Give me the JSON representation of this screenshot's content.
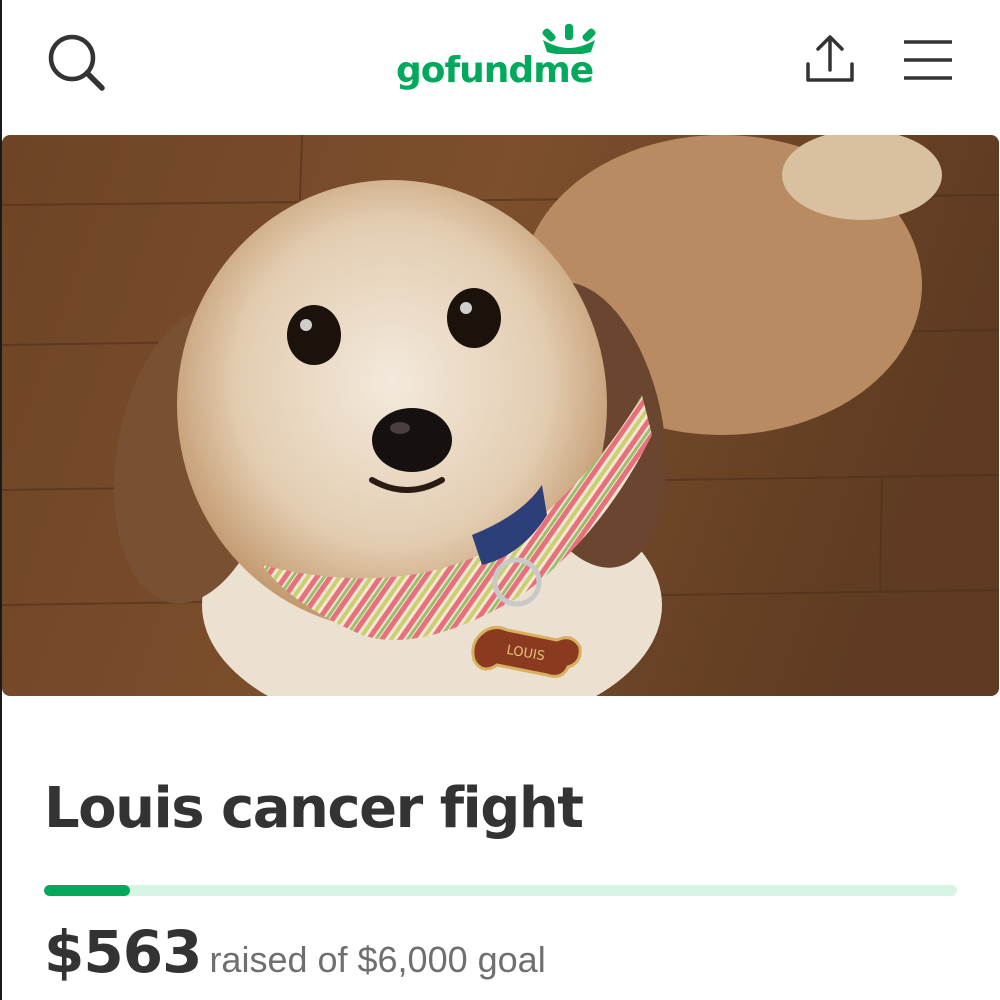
{
  "header": {
    "logo_text": "gofundme",
    "icons": {
      "search": "search-icon",
      "share": "share-icon",
      "menu": "hamburger-menu-icon"
    }
  },
  "hero": {
    "subject": "dog-photo",
    "tag_text": "LOUIS"
  },
  "campaign": {
    "title": "Louis cancer fight",
    "raised": "$563",
    "goal_text": "raised of $6,000 goal",
    "progress_fraction": 0.094
  },
  "colors": {
    "brand": "#02a95c",
    "progress_track": "#d6f5e5",
    "title_text": "#333333",
    "secondary_text": "#6f6f6f"
  }
}
